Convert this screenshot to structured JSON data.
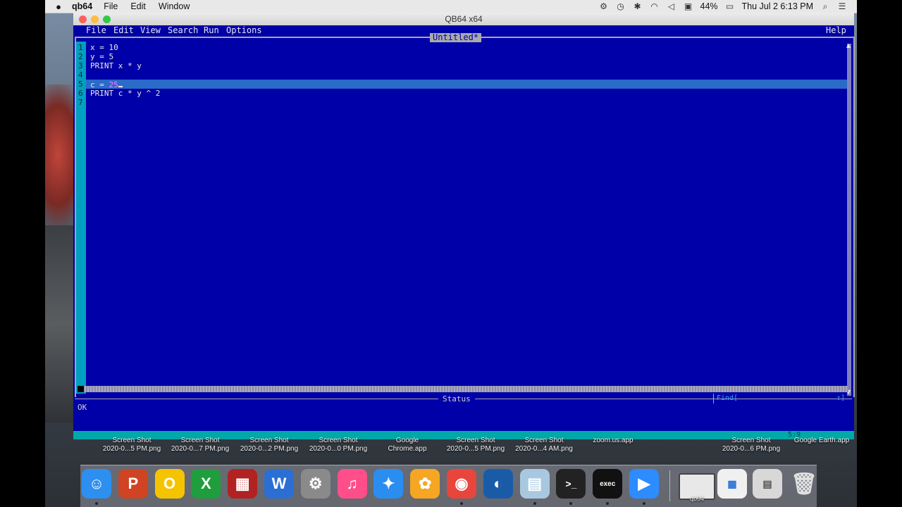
{
  "os_menubar": {
    "app_name": "qb64",
    "menus": [
      "File",
      "Edit",
      "Window"
    ],
    "battery": "44%",
    "clock": "Thu Jul 2  6:13 PM"
  },
  "window": {
    "title": "QB64 x64"
  },
  "qb_menu": {
    "items": [
      "File",
      "Edit",
      "View",
      "Search",
      "Run",
      "Options"
    ],
    "help": "Help"
  },
  "editor": {
    "tab_title": "Untitled*",
    "line_numbers": [
      "1",
      "2",
      "3",
      "4",
      "5",
      "6",
      "7"
    ],
    "lines": [
      "x = 10",
      "y = 5",
      "PRINT x * y",
      "",
      "c = ",
      "PRINT c * y ^ 2",
      ""
    ],
    "line5_literal": "25",
    "current_line": 5
  },
  "status": {
    "title": "Status",
    "message": "OK",
    "find_label": "Find[",
    "find_arrow": "↕]",
    "cursor_position": "5:9"
  },
  "desktop_files": [
    {
      "line1": "Screen Shot",
      "line2": "2020-0...5 PM.png"
    },
    {
      "line1": "Screen Shot",
      "line2": "2020-0...7 PM.png"
    },
    {
      "line1": "Screen Shot",
      "line2": "2020-0...2 PM.png"
    },
    {
      "line1": "Screen Shot",
      "line2": "2020-0...0 PM.png"
    },
    {
      "line1": "Google",
      "line2": "Chrome.app"
    },
    {
      "line1": "Screen Shot",
      "line2": "2020-0...5 PM.png"
    },
    {
      "line1": "Screen Shot",
      "line2": "2020-0...4 AM.png"
    },
    {
      "line1": "",
      "line2": "zoom.us.app"
    },
    {
      "line1": "Screen Shot",
      "line2": "2020-0...6 PM.png"
    },
    {
      "line1": "Google Earth.app",
      "line2": ""
    }
  ],
  "dock": {
    "apps": [
      {
        "name": "finder-icon",
        "glyph": "☺",
        "color": "#2d8ff0"
      },
      {
        "name": "powerpoint-icon",
        "glyph": "P",
        "color": "#d04423"
      },
      {
        "name": "outlook-icon",
        "glyph": "O",
        "color": "#f5c400"
      },
      {
        "name": "excel-icon",
        "glyph": "X",
        "color": "#1f9e3e"
      },
      {
        "name": "photobooth-icon",
        "glyph": "▦",
        "color": "#b22222"
      },
      {
        "name": "word-icon",
        "glyph": "W",
        "color": "#2b6fd4"
      },
      {
        "name": "system-preferences-icon",
        "glyph": "⚙",
        "color": "#8a8a8a"
      },
      {
        "name": "itunes-icon",
        "glyph": "♫",
        "color": "#ff4e8a"
      },
      {
        "name": "safari-icon",
        "glyph": "✦",
        "color": "#2a8ef0"
      },
      {
        "name": "photos-icon",
        "glyph": "✿",
        "color": "#f5a623"
      },
      {
        "name": "chrome-icon",
        "glyph": "◉",
        "color": "#e8453c"
      },
      {
        "name": "google-earth-icon",
        "glyph": "◐",
        "color": "#1a5ba8"
      },
      {
        "name": "preview-icon",
        "glyph": "▤",
        "color": "#a8c8e0"
      },
      {
        "name": "terminal-icon",
        "glyph": ">_",
        "color": "#222222"
      },
      {
        "name": "exec-icon",
        "glyph": "exec",
        "color": "#111111"
      },
      {
        "name": "zoom-icon",
        "glyph": "▶",
        "color": "#2d8cff"
      }
    ],
    "right_items": [
      {
        "name": "qb64-window-thumb",
        "label": "qb64"
      },
      {
        "name": "pages-thumb",
        "label": ""
      },
      {
        "name": "keynote-thumb",
        "label": ""
      },
      {
        "name": "trash-icon",
        "label": ""
      }
    ]
  }
}
